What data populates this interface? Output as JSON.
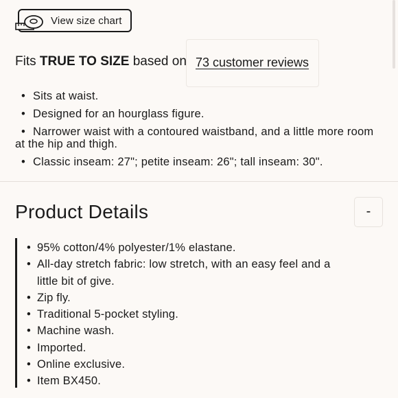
{
  "size_chart": {
    "label": "View size chart",
    "icon": "tape-measure-icon"
  },
  "fit": {
    "prefix": "Fits ",
    "emphasis": "TRUE TO SIZE",
    "suffix": " based on",
    "reviews_link": "73 customer reviews",
    "notes": [
      "Sits at waist.",
      "Designed for an hourglass figure.",
      "Narrower waist with a contoured waistband, and a little more room at the hip and thigh.",
      "Classic inseam: 27\"; petite inseam: 26\"; tall inseam: 30\"."
    ]
  },
  "product_details": {
    "title": "Product Details",
    "toggle_label": "-",
    "items": [
      "95% cotton/4% polyester/1% elastane.",
      "All-day stretch fabric: low stretch, with an easy feel and a little bit of give.",
      "Zip fly.",
      "Traditional 5-pocket styling.",
      "Machine wash.",
      "Imported.",
      "Online exclusive.",
      "Item BX450."
    ]
  }
}
